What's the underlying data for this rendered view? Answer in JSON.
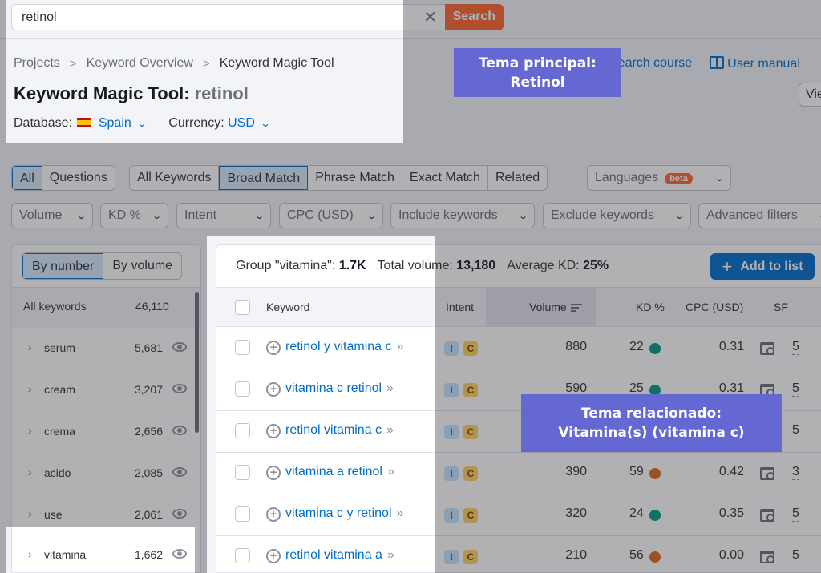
{
  "search": {
    "value": "retinol",
    "clear_icon": "close-icon",
    "button_label": "Search"
  },
  "breadcrumb": {
    "items": [
      "Projects",
      "Keyword Overview",
      "Keyword Magic Tool"
    ],
    "separator": ">"
  },
  "header": {
    "title": "Keyword Magic Tool:",
    "keyword": "retinol",
    "database_label": "Database:",
    "database_value": "Spain",
    "currency_label": "Currency:",
    "currency_value": "USD",
    "links": [
      "Search course",
      "User manual"
    ],
    "view_button": "View"
  },
  "filters": {
    "question_tabs": [
      "All",
      "Questions"
    ],
    "question_active": "All",
    "match_tabs": [
      "All Keywords",
      "Broad Match",
      "Phrase Match",
      "Exact Match",
      "Related"
    ],
    "match_active": "Broad Match",
    "languages": {
      "label": "Languages",
      "badge": "beta"
    },
    "dropdowns": [
      "Volume",
      "KD %",
      "Intent",
      "CPC (USD)",
      "Include keywords",
      "Exclude keywords",
      "Advanced filters"
    ]
  },
  "groups": {
    "toggle": [
      "By number",
      "By volume"
    ],
    "toggle_active": "By number",
    "all_label": "All keywords",
    "all_count": "46,110",
    "items": [
      {
        "label": "serum",
        "count": "5,681"
      },
      {
        "label": "cream",
        "count": "3,207"
      },
      {
        "label": "crema",
        "count": "2,656"
      },
      {
        "label": "acido",
        "count": "2,085"
      },
      {
        "label": "use",
        "count": "2,061"
      },
      {
        "label": "vitamina",
        "count": "1,662"
      }
    ]
  },
  "table": {
    "summary": {
      "group_label": "Group \"vitamina\":",
      "group_value": "1.7K",
      "total_label": "Total volume:",
      "total_value": "13,180",
      "kd_label": "Average KD:",
      "kd_value": "25%"
    },
    "add_button": "Add to list",
    "columns": [
      "Keyword",
      "Intent",
      "Volume",
      "KD %",
      "CPC (USD)",
      "SF"
    ],
    "rows": [
      {
        "keyword": "retinol y vitamina c",
        "intent": [
          "I",
          "C"
        ],
        "volume": "880",
        "kd": "22",
        "kd_color": "#009f81",
        "cpc": "0.31",
        "sf": "5"
      },
      {
        "keyword": "vitamina c retinol",
        "intent": [
          "I",
          "C"
        ],
        "volume": "590",
        "kd": "25",
        "kd_color": "#009f81",
        "cpc": "0.31",
        "sf": "5"
      },
      {
        "keyword": "retinol vitamina c",
        "intent": [
          "I",
          "C"
        ],
        "volume": "",
        "kd": "",
        "kd_color": "",
        "cpc": "",
        "sf": "5"
      },
      {
        "keyword": "vitamina a retinol",
        "intent": [
          "I",
          "C"
        ],
        "volume": "390",
        "kd": "59",
        "kd_color": "#e0691b",
        "cpc": "0.42",
        "sf": "3"
      },
      {
        "keyword": "vitamina c y retinol",
        "intent": [
          "I",
          "C"
        ],
        "volume": "320",
        "kd": "24",
        "kd_color": "#009f81",
        "cpc": "0.35",
        "sf": "5"
      },
      {
        "keyword": "retinol vitamina a",
        "intent": [
          "I",
          "C"
        ],
        "volume": "210",
        "kd": "56",
        "kd_color": "#e0691b",
        "cpc": "0.00",
        "sf": "5"
      }
    ]
  },
  "annotations": {
    "main_topic": "Tema principal: Retinol",
    "related_topic": "Tema relacionado: Vitamina(s) (vitamina c)"
  },
  "colors": {
    "accent": "#006dca",
    "search_button": "#ff642d",
    "callout": "#6568d3",
    "kd_easy": "#009f81",
    "kd_hard": "#e0691b"
  }
}
